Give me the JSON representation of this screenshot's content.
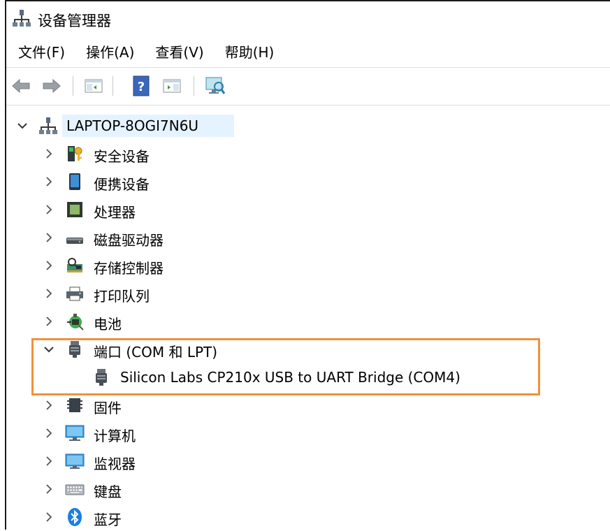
{
  "window": {
    "title": "设备管理器"
  },
  "menu": {
    "items": [
      {
        "label": "文件(F)"
      },
      {
        "label": "操作(A)"
      },
      {
        "label": "查看(V)"
      },
      {
        "label": "帮助(H)"
      }
    ]
  },
  "toolbar": {
    "buttons": [
      {
        "icon": "back-arrow-icon"
      },
      {
        "icon": "forward-arrow-icon"
      },
      {
        "icon": "show-hide-console-tree-icon"
      },
      {
        "icon": "help-icon"
      },
      {
        "icon": "properties-pane-icon"
      },
      {
        "icon": "scan-hardware-icon"
      }
    ]
  },
  "tree": {
    "root": {
      "label": "LAPTOP-8OGI7N6U",
      "expanded": true
    },
    "nodes": [
      {
        "label": "安全设备",
        "icon": "security-device-icon",
        "expanded": false
      },
      {
        "label": "便携设备",
        "icon": "portable-device-icon",
        "expanded": false
      },
      {
        "label": "处理器",
        "icon": "processor-icon",
        "expanded": false
      },
      {
        "label": "磁盘驱动器",
        "icon": "disk-drive-icon",
        "expanded": false
      },
      {
        "label": "存储控制器",
        "icon": "storage-controller-icon",
        "expanded": false
      },
      {
        "label": "打印队列",
        "icon": "print-queue-icon",
        "expanded": false
      },
      {
        "label": "电池",
        "icon": "battery-icon",
        "expanded": false
      },
      {
        "label": "端口 (COM 和 LPT)",
        "icon": "port-icon",
        "expanded": true,
        "children": [
          {
            "label": "Silicon Labs CP210x USB to UART Bridge (COM4)",
            "icon": "port-icon"
          }
        ]
      },
      {
        "label": "固件",
        "icon": "firmware-icon",
        "expanded": false
      },
      {
        "label": "计算机",
        "icon": "computer-icon",
        "expanded": false
      },
      {
        "label": "监视器",
        "icon": "monitor-icon",
        "expanded": false
      },
      {
        "label": "键盘",
        "icon": "keyboard-icon",
        "expanded": false
      },
      {
        "label": "蓝牙",
        "icon": "bluetooth-icon",
        "expanded": false
      }
    ]
  },
  "colors": {
    "highlight_border": "#f0913a",
    "selection_bg": "#e5f3ff"
  }
}
